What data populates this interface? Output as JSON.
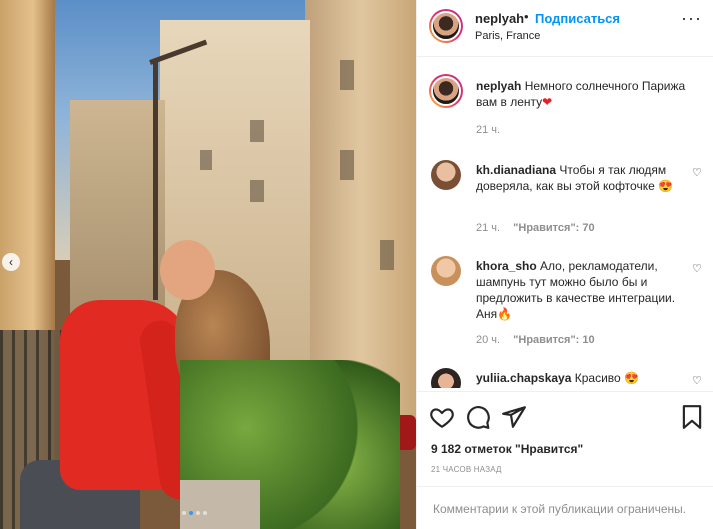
{
  "post": {
    "username": "neplyah",
    "follow_label": "Подписаться",
    "separator": "•",
    "location": "Paris, France",
    "more_icon": "more-icon"
  },
  "caption": {
    "username": "neplyah",
    "text": "Немного солнечного Парижа вам в ленту",
    "emoji": "❤",
    "time": "21 ч."
  },
  "comments": [
    {
      "username": "kh.dianadiana",
      "text": "Чтобы я так людям доверяла, как вы этой кофточке",
      "emoji": "😍",
      "time": "21 ч.",
      "likes": "\"Нравится\": 70"
    },
    {
      "username": "khora_sho",
      "text": "Ало, рекламодатели, шампунь тут можно было бы и предложить в качестве интеграции. Аня",
      "emoji": "🔥",
      "time": "20 ч.",
      "likes": "\"Нравится\": 10"
    },
    {
      "username": "yuliia.chapskaya",
      "text": "Красиво",
      "emoji": "😍"
    }
  ],
  "actions": {
    "like_icon": "heart-icon",
    "comment_icon": "comment-icon",
    "share_icon": "send-icon",
    "save_icon": "bookmark-icon"
  },
  "likes_text": "9 182 отметок \"Нравится\"",
  "timestamp": "21 ЧАСОВ НАЗАД",
  "footer_text": "Комментарии к этой публикации ограничены.",
  "carousel": {
    "prev_glyph": "‹",
    "dot_count": 4,
    "active_dot": 1
  }
}
